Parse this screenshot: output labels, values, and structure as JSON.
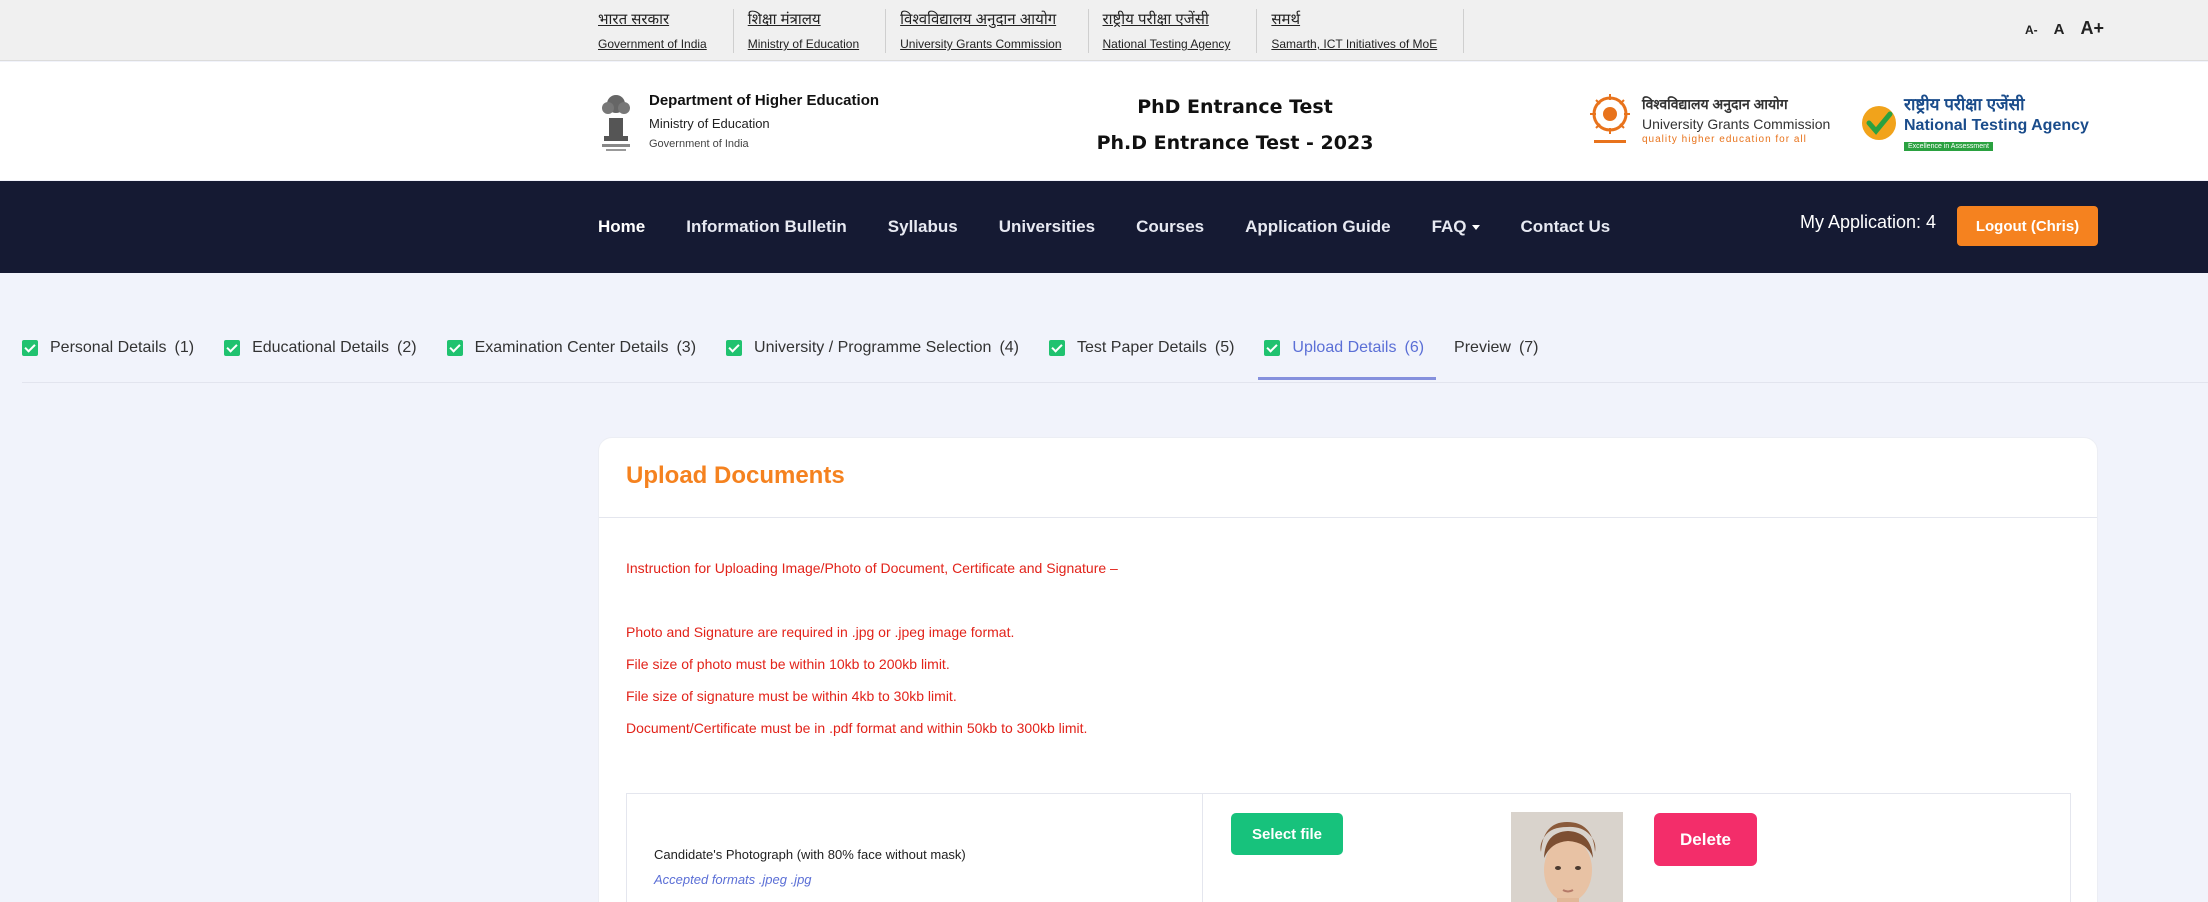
{
  "gov_links": [
    {
      "hi": "भारत सरकार",
      "en": "Government of India"
    },
    {
      "hi": "शिक्षा मंत्रालय",
      "en": "Ministry of Education"
    },
    {
      "hi": "विश्वविद्यालय अनुदान आयोग",
      "en": "University Grants Commission"
    },
    {
      "hi": "राष्ट्रीय परीक्षा एजेंसी",
      "en": "National Testing Agency"
    },
    {
      "hi": "समर्थ",
      "en": "Samarth, ICT Initiatives of MoE"
    }
  ],
  "font_size": {
    "small": "A-",
    "normal": "A",
    "large": "A+"
  },
  "header": {
    "dept_line1": "Department of Higher Education",
    "dept_line2": "Ministry of Education",
    "dept_line3": "Government of India",
    "title1": "PhD Entrance Test",
    "title2": "Ph.D Entrance Test - 2023",
    "ugc_hi": "विश्वविद्यालय अनुदान आयोग",
    "ugc_en": "University Grants Commission",
    "ugc_tag": "quality higher education for all",
    "nta_hi": "राष्ट्रीय परीक्षा एजेंसी",
    "nta_en": "National Testing Agency",
    "nta_badge": "Excellence in Assessment"
  },
  "nav": {
    "items": [
      "Home",
      "Information Bulletin",
      "Syllabus",
      "Universities",
      "Courses",
      "Application Guide",
      "FAQ",
      "Contact Us"
    ],
    "my_application": "My Application: 4",
    "logout": "Logout (Chris)"
  },
  "steps": [
    {
      "label": "Personal Details",
      "num": "(1)"
    },
    {
      "label": "Educational Details",
      "num": "(2)"
    },
    {
      "label": "Examination Center Details",
      "num": "(3)"
    },
    {
      "label": "University / Programme Selection",
      "num": "(4)"
    },
    {
      "label": "Test Paper Details",
      "num": "(5)"
    },
    {
      "label": "Upload Details",
      "num": "(6)"
    },
    {
      "label": "Preview",
      "num": "(7)"
    }
  ],
  "card": {
    "title": "Upload Documents",
    "instr_heading": "Instruction for Uploading Image/Photo of Document, Certificate and Signature –",
    "instr_lines": [
      "Photo and Signature are required in .jpg or .jpeg image format.",
      "File size of photo must be within 10kb to 200kb limit.",
      "File size of signature must be within 4kb to 30kb limit.",
      "Document/Certificate must be in .pdf format and within 50kb to 300kb limit."
    ],
    "photo_label": "Candidate's Photograph (with 80% face without mask)",
    "photo_formats": "Accepted formats .jpeg .jpg",
    "select_file": "Select file",
    "delete": "Delete"
  }
}
